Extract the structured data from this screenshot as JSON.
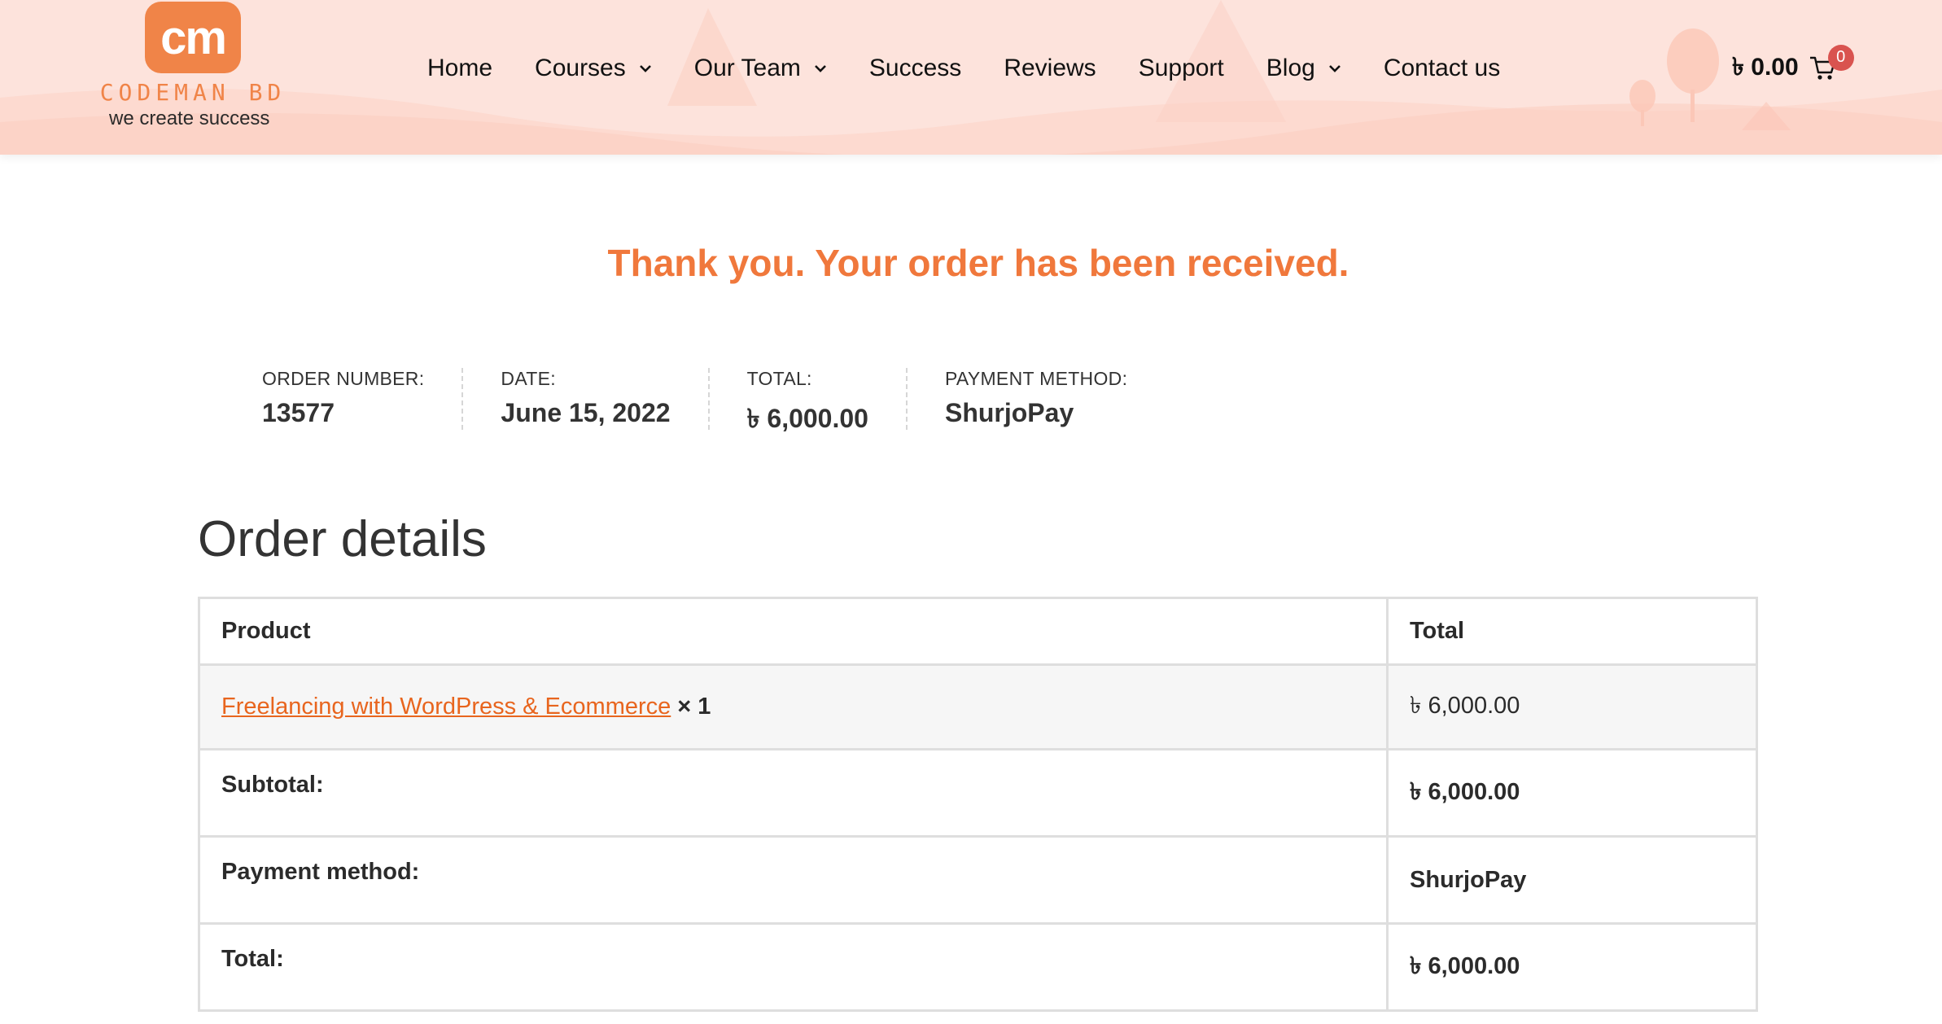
{
  "brand": {
    "logo_mark": "cm",
    "logo_wordmark": "CODEMAN BD",
    "tagline": "we create success",
    "accent_color": "#f08448"
  },
  "nav": {
    "items": [
      {
        "label": "Home",
        "has_dropdown": false
      },
      {
        "label": "Courses",
        "has_dropdown": true
      },
      {
        "label": "Our Team",
        "has_dropdown": true
      },
      {
        "label": "Success",
        "has_dropdown": false
      },
      {
        "label": "Reviews",
        "has_dropdown": false
      },
      {
        "label": "Support",
        "has_dropdown": false
      },
      {
        "label": "Blog",
        "has_dropdown": true
      },
      {
        "label": "Contact us",
        "has_dropdown": false
      }
    ]
  },
  "cart": {
    "amount": "৳ 0.00",
    "count": "0",
    "icon": "cart-icon"
  },
  "thanks_message": "Thank you. Your order has been received.",
  "order_overview": {
    "order_number_label": "ORDER NUMBER:",
    "order_number": "13577",
    "date_label": "DATE:",
    "date": "June 15, 2022",
    "total_label": "TOTAL:",
    "total": "৳ 6,000.00",
    "payment_label": "PAYMENT METHOD:",
    "payment": "ShurjoPay"
  },
  "order_details": {
    "title": "Order details",
    "headers": {
      "product": "Product",
      "total": "Total"
    },
    "item": {
      "name": "Freelancing with WordPress & Ecommerce",
      "qty": "× 1",
      "total": "৳ 6,000.00"
    },
    "rows": [
      {
        "label": "Subtotal:",
        "value": "৳ 6,000.00"
      },
      {
        "label": "Payment method:",
        "value": "ShurjoPay"
      },
      {
        "label": "Total:",
        "value": "৳ 6,000.00"
      }
    ]
  }
}
